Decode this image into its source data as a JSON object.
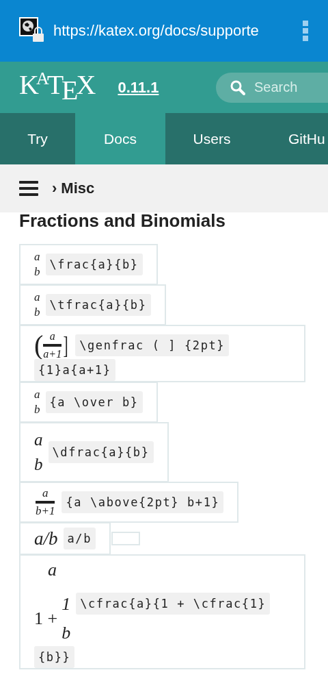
{
  "browser": {
    "url": "https://katex.org/docs/supporte"
  },
  "header": {
    "logo": "KATEX",
    "version": "0.11.1",
    "search": {
      "placeholder": "Search"
    }
  },
  "tabs": [
    {
      "label": "Try",
      "selected": false
    },
    {
      "label": "Docs",
      "selected": true
    },
    {
      "label": "Users",
      "selected": false
    },
    {
      "label": "GitHu",
      "selected": false
    }
  ],
  "breadcrumb": {
    "separator": "›",
    "title": "Misc"
  },
  "heading": "Fractions and Binomials",
  "rows": [
    {
      "math": {
        "kind": "stack",
        "num": "a",
        "den": "b"
      },
      "code": [
        "\\frac{a}{b}"
      ]
    },
    {
      "math": {
        "kind": "stack",
        "num": "a",
        "den": "b"
      },
      "code": [
        "\\tfrac{a}{b}"
      ]
    },
    {
      "math": {
        "kind": "genfrac",
        "left": "(",
        "right": "]",
        "num": "a",
        "den": "a+1"
      },
      "code": [
        "\\genfrac ( ] {2pt}",
        "{1}a{a+1}"
      ]
    },
    {
      "math": {
        "kind": "stack",
        "num": "a",
        "den": "b"
      },
      "code": [
        "{a \\over b}"
      ]
    },
    {
      "math": {
        "kind": "dstack",
        "num": "a",
        "den": "b"
      },
      "code": [
        "\\dfrac{a}{b}"
      ]
    },
    {
      "math": {
        "kind": "ruled",
        "num": "a",
        "den": "b+1"
      },
      "code": [
        "{a \\above{2pt} b+1}"
      ]
    },
    {
      "math": {
        "kind": "inline",
        "text": "a/b"
      },
      "code": [
        "a/b"
      ],
      "extra_cell": true
    },
    {
      "math": {
        "kind": "cfrac",
        "num": "a",
        "lead": "1 +",
        "inner_num": "1",
        "inner_den": "b"
      },
      "code": [
        "\\cfrac{a}{1 + \\cfrac{1}",
        "{b}}"
      ]
    }
  ]
}
